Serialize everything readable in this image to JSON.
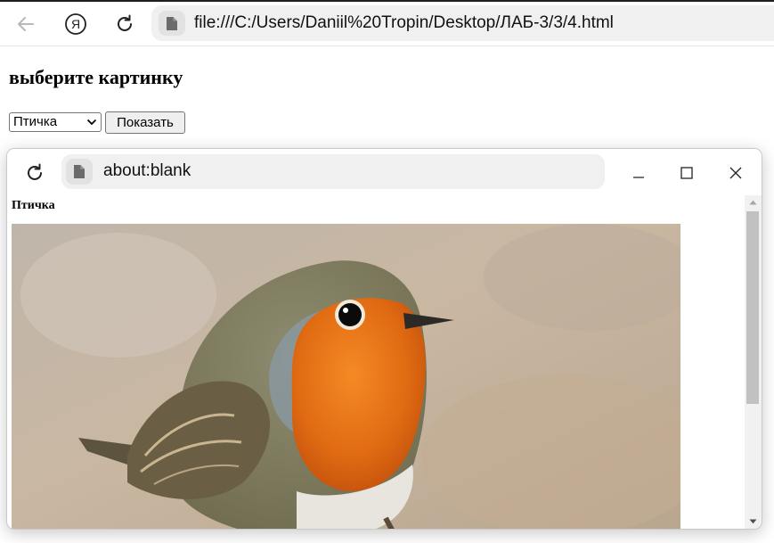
{
  "browser": {
    "url": "file:///C:/Users/Daniil%20Tropin/Desktop/ЛАБ-3/3/4.html",
    "yandex_letter": "Я",
    "icons": [
      "back-arrow-icon",
      "yandex-icon",
      "reload-icon",
      "file-icon"
    ]
  },
  "page": {
    "heading": "выберите картинку",
    "select_value": "Птичка",
    "show_button": "Показать"
  },
  "popup": {
    "url": "about:blank",
    "heading": "Птичка",
    "image_subject": "robin bird photo",
    "icons": [
      "reload-icon",
      "file-icon",
      "minimize-icon",
      "maximize-icon",
      "close-icon"
    ]
  },
  "colors": {
    "accent_orange": "#e8731c",
    "bird_gray": "#8b8f86",
    "background_blur": "#c8b8a4"
  }
}
